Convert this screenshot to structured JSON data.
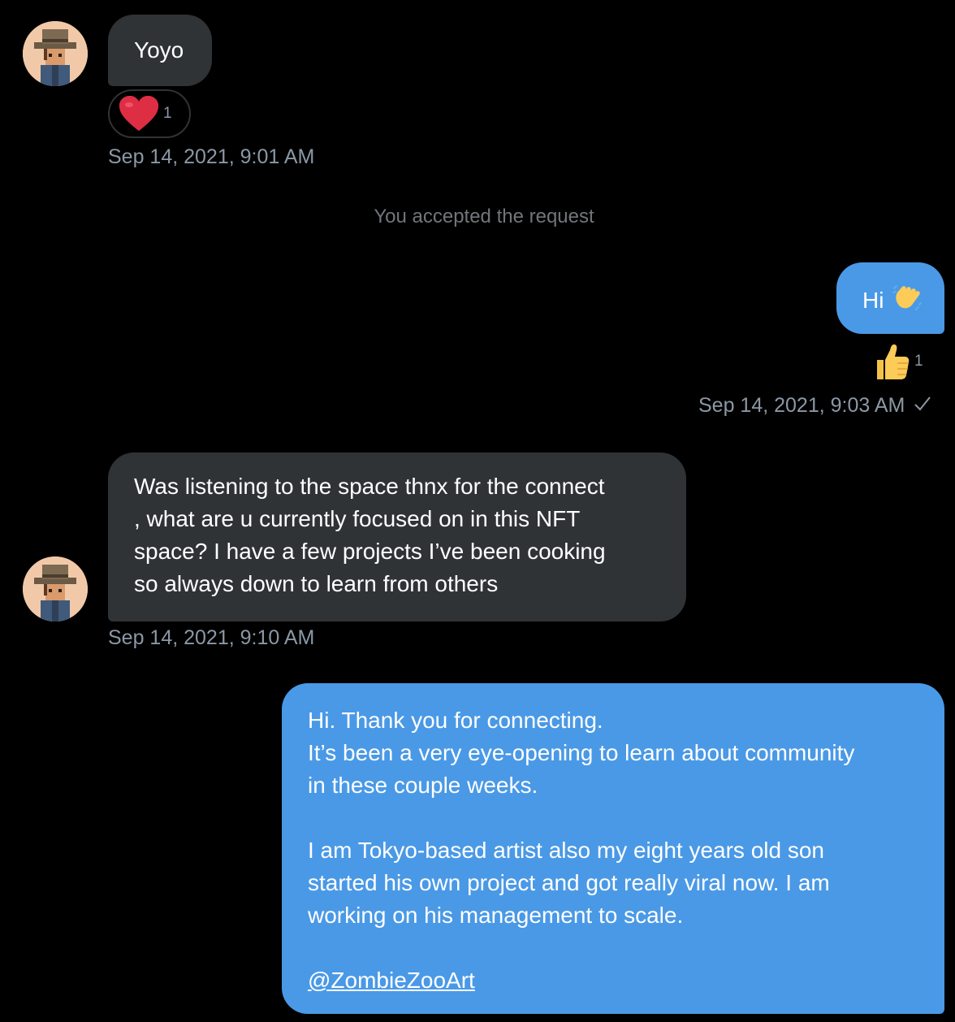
{
  "messages": [
    {
      "direction": "incoming",
      "text": "Yoyo",
      "reaction": {
        "emoji": "heart-icon",
        "count": "1"
      },
      "timestamp": "Sep 14, 2021, 9:01 AM"
    },
    {
      "direction": "system",
      "text": "You accepted the request"
    },
    {
      "direction": "outgoing",
      "text": "Hi",
      "emoji": "waving-hand-icon",
      "reaction": {
        "emoji": "thumbs-up-icon",
        "count": "1"
      },
      "timestamp": "Sep 14, 2021, 9:03 AM",
      "status_icon": "checkmark-icon"
    },
    {
      "direction": "incoming",
      "lines": [
        "Was listening to the space thnx for the connect",
        ", what are u currently focused on in this NFT",
        "space? I have a few projects I’ve been cooking",
        "so always down to learn from others"
      ],
      "timestamp": "Sep 14, 2021, 9:10 AM"
    },
    {
      "direction": "outgoing",
      "lines": [
        "Hi. Thank you for connecting.",
        "It’s been a very eye-opening to learn about community",
        "in these couple weeks.",
        "",
        "I am Tokyo-based artist also my eight years old son",
        "started his own project and got really viral now. I am",
        "working on his management to scale.",
        "",
        "@ZombieZooArt"
      ],
      "link_text": "@ZombieZooArt"
    }
  ],
  "colors": {
    "background": "#000000",
    "incoming_bubble": "#2f3336",
    "outgoing_bubble": "#4a99e6",
    "timestamp": "#8b98a5"
  }
}
